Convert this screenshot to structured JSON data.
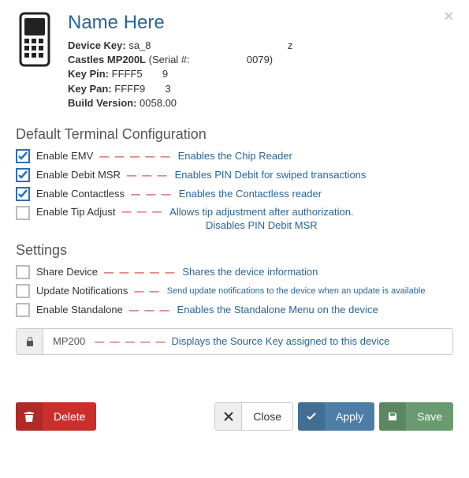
{
  "header": {
    "title": "Name Here",
    "device_key_label": "Device Key:",
    "device_key_value": "sa_8                                                z",
    "serial_label": "Castles MP200L",
    "serial_paren": "(Serial #:                    0079)",
    "key_pin_label": "Key Pin:",
    "key_pin_value": "FFFF5       9",
    "key_pan_label": "Key Pan:",
    "key_pan_value": "FFFF9       3",
    "build_label": "Build Version:",
    "build_value": "0058.00"
  },
  "sections": {
    "terminal_title": "Default Terminal Configuration",
    "settings_title": "Settings"
  },
  "terminal": [
    {
      "label": "Enable EMV",
      "desc": "Enables the Chip Reader",
      "checked": true,
      "dashes": "— — — — —"
    },
    {
      "label": "Enable Debit MSR",
      "desc": "Enables PIN Debit for swiped transactions",
      "checked": true,
      "dashes": "— — —"
    },
    {
      "label": "Enable Contactless",
      "desc": "Enables the Contactless reader",
      "checked": true,
      "dashes": "— — —"
    },
    {
      "label": "Enable Tip Adjust",
      "desc": "Allows tip adjustment after authorization.",
      "desc2": "Disables PIN Debit MSR",
      "checked": false,
      "dashes": "— — —"
    }
  ],
  "settings": [
    {
      "label": "Share Device",
      "desc": "Shares the device information",
      "checked": false,
      "dashes": "— — — — —"
    },
    {
      "label": "Update Notifications",
      "desc": "Send update notifications to the device when an update is available",
      "checked": false,
      "small": true,
      "dashes": "— —"
    },
    {
      "label": "Enable Standalone",
      "desc": "Enables the Standalone Menu on the device",
      "checked": false,
      "dashes": "— — —"
    }
  ],
  "sourcekey": {
    "name": "MP200",
    "desc": "Displays the Source Key assigned to this device",
    "dashes": "— — — — —"
  },
  "buttons": {
    "delete": "Delete",
    "close": "Close",
    "apply": "Apply",
    "save": "Save"
  }
}
